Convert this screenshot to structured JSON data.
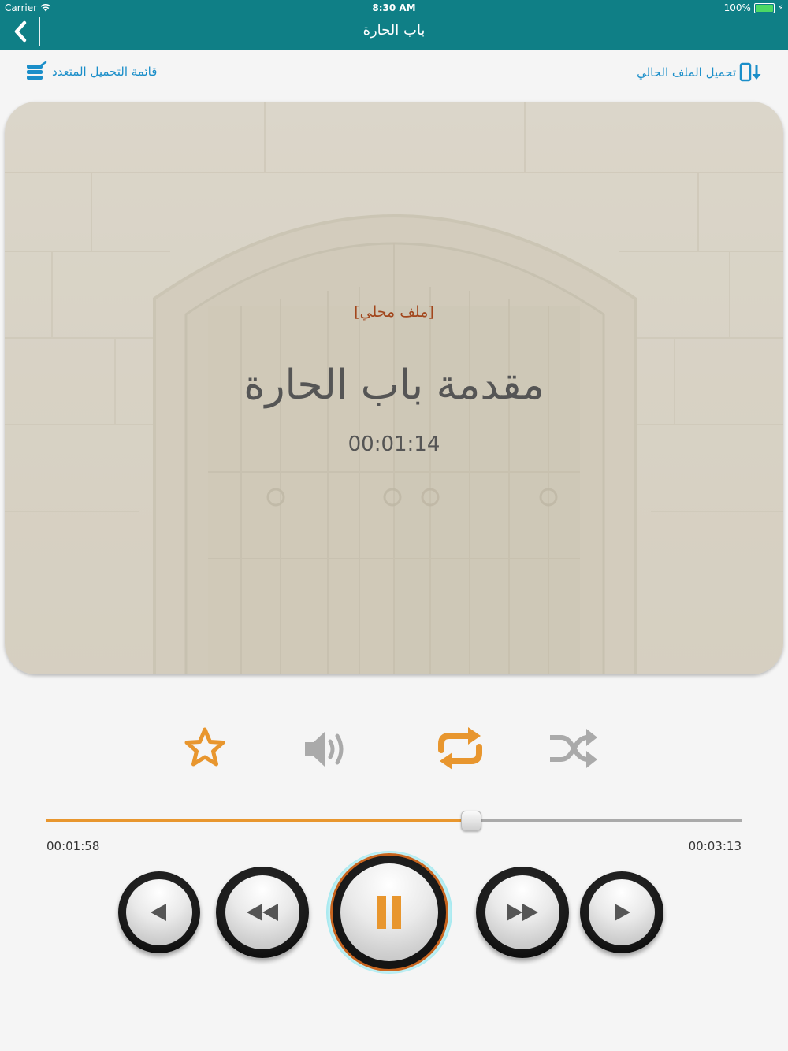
{
  "status_bar": {
    "carrier": "Carrier",
    "time": "8:30 AM",
    "battery": "100%"
  },
  "nav": {
    "title": "باب الحارة"
  },
  "links": {
    "multi_download_list": "قائمة التحميل المتعدد",
    "download_current_file": "تحميل الملف الحالي"
  },
  "track": {
    "source_label": "[ملف محلي]",
    "title": "مقدمة باب الحارة",
    "duration": "00:01:14"
  },
  "progress": {
    "elapsed": "00:01:58",
    "total": "00:03:13",
    "fraction": 0.61
  },
  "controls": {
    "favorite_icon": "star-icon",
    "volume_icon": "volume-icon",
    "repeat_icon": "repeat-icon",
    "shuffle_icon": "shuffle-icon",
    "repeat_active": true,
    "shuffle_active": false
  },
  "colors": {
    "nav_bg": "#0f7f86",
    "accent_orange": "#e8962e",
    "link_blue": "#1a8ec9",
    "local_label": "#a2461c"
  }
}
